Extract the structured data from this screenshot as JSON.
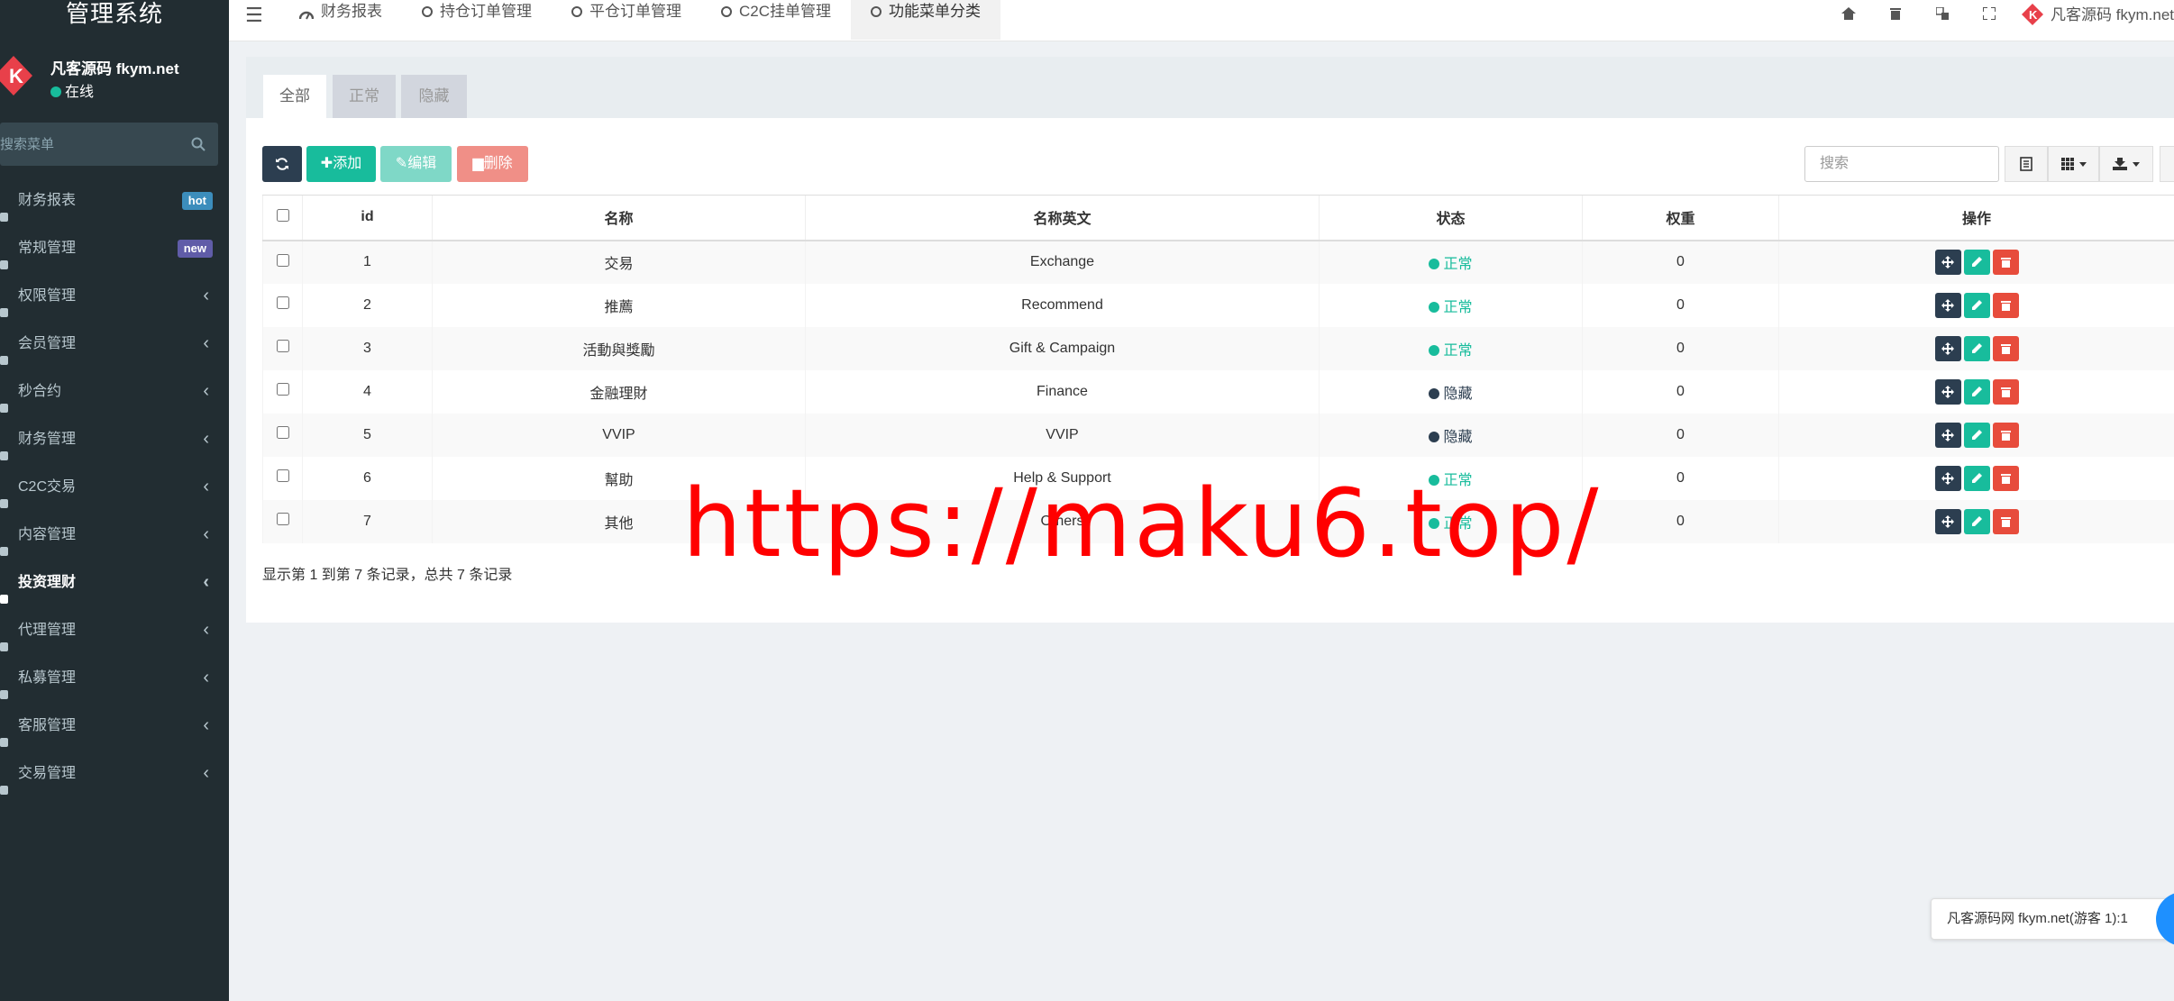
{
  "sidebar": {
    "logo": "管理系统",
    "user": {
      "name": "凡客源码 fkym.net",
      "status": "在线"
    },
    "search_placeholder": "搜索菜单",
    "items": [
      {
        "label": "财务报表",
        "icon": "chart-icon",
        "badge": "hot"
      },
      {
        "label": "常规管理",
        "icon": "cogs-icon",
        "badge": "new"
      },
      {
        "label": "权限管理",
        "icon": "group-icon"
      },
      {
        "label": "会员管理",
        "icon": "list-icon"
      },
      {
        "label": "秒合约",
        "icon": "calendar-icon"
      },
      {
        "label": "财务管理",
        "icon": "database-icon"
      },
      {
        "label": "C2C交易",
        "icon": "exchange-icon"
      },
      {
        "label": "内容管理",
        "icon": "content-icon"
      },
      {
        "label": "投资理财",
        "icon": "check-circle-icon",
        "active": true
      },
      {
        "label": "代理管理",
        "icon": "building-icon"
      },
      {
        "label": "私募管理",
        "icon": "gem-icon"
      },
      {
        "label": "客服管理",
        "icon": "comment-icon"
      },
      {
        "label": "交易管理",
        "icon": "handshake-icon"
      }
    ]
  },
  "topnav": {
    "tabs": [
      {
        "label": "财务报表",
        "icon": "dashboard-icon"
      },
      {
        "label": "持仓订单管理",
        "icon": "circle-icon"
      },
      {
        "label": "平仓订单管理",
        "icon": "circle-icon"
      },
      {
        "label": "C2C挂单管理",
        "icon": "circle-icon"
      },
      {
        "label": "功能菜单分类",
        "icon": "circle-icon",
        "active": true
      }
    ],
    "user_label": "凡客源码 fkym.net"
  },
  "subtabs": [
    "全部",
    "正常",
    "隐藏"
  ],
  "toolbar": {
    "add": "添加",
    "edit": "编辑",
    "delete": "删除",
    "search_placeholder": "搜索"
  },
  "table": {
    "headers": [
      "id",
      "名称",
      "名称英文",
      "状态",
      "权重",
      "操作"
    ],
    "rows": [
      {
        "id": "1",
        "name": "交易",
        "name_en": "Exchange",
        "status": "正常",
        "weight": "0"
      },
      {
        "id": "2",
        "name": "推薦",
        "name_en": "Recommend",
        "status": "正常",
        "weight": "0"
      },
      {
        "id": "3",
        "name": "活動與獎勵",
        "name_en": "Gift & Campaign",
        "status": "正常",
        "weight": "0"
      },
      {
        "id": "4",
        "name": "金融理財",
        "name_en": "Finance",
        "status": "隐藏",
        "weight": "0"
      },
      {
        "id": "5",
        "name": "VVIP",
        "name_en": "VVIP",
        "status": "隐藏",
        "weight": "0"
      },
      {
        "id": "6",
        "name": "幫助",
        "name_en": "Help & Support",
        "status": "正常",
        "weight": "0"
      },
      {
        "id": "7",
        "name": "其他",
        "name_en": "Others",
        "status": "正常",
        "weight": "0"
      }
    ]
  },
  "pagination": "显示第 1 到第 7 条记录，总共 7 条记录",
  "watermark": "https://maku6.top/",
  "chat_tip": "凡客源码网 fkym.net(游客 1):1",
  "colors": {
    "sidebar_bg": "#222d32",
    "success": "#18bc9c",
    "danger": "#e74c3c",
    "dark": "#2c3e50",
    "status_normal": "#18bc9c",
    "status_hidden": "#2c3e50"
  }
}
